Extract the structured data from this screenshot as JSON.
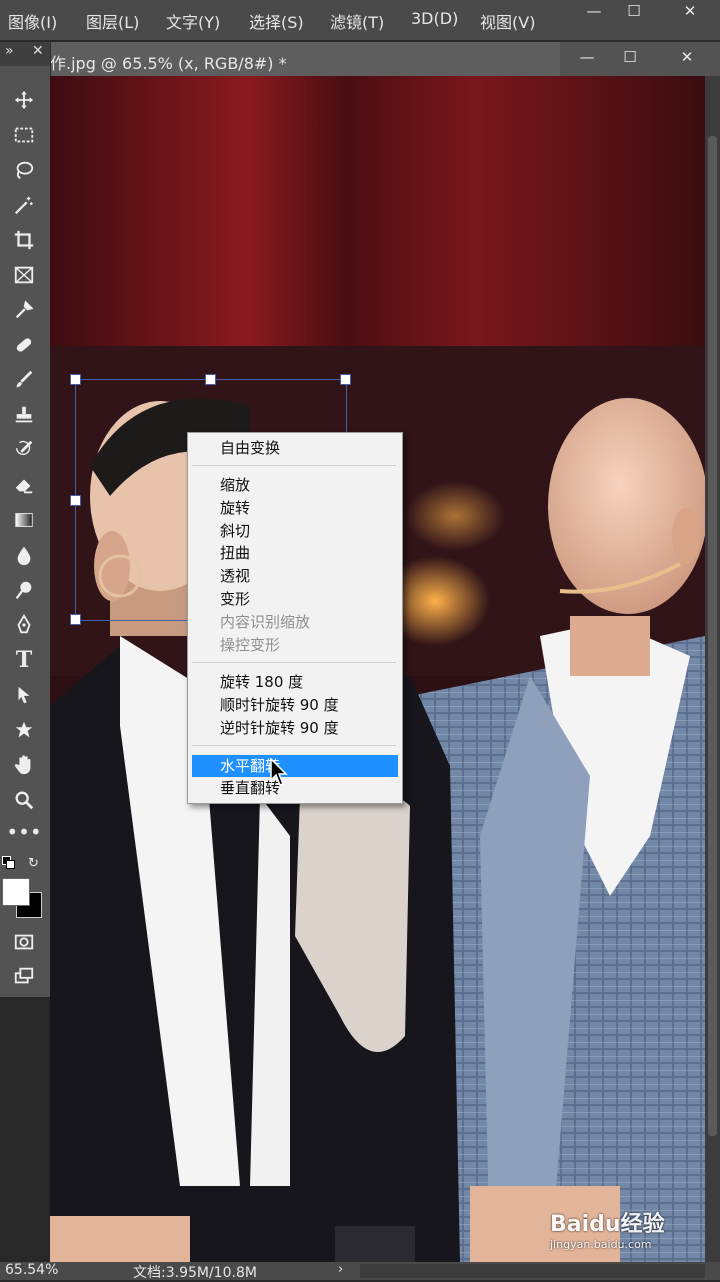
{
  "menubar": {
    "items": [
      "图像(I)",
      "图层(L)",
      "文字(Y)",
      "选择(S)",
      "滤镜(T)",
      "3D(D)",
      "视图(V)"
    ],
    "window_controls": [
      "—",
      "☐",
      "✕"
    ]
  },
  "document": {
    "tab_title": "作.jpg @ 65.5% (x, RGB/8#) *",
    "controls": [
      "—",
      "☐",
      "✕"
    ]
  },
  "toolbar": {
    "header_controls": [
      "»",
      "✕"
    ],
    "tools": [
      "move",
      "marquee",
      "lasso",
      "magic-wand",
      "crop",
      "frame",
      "eyedropper",
      "healing-brush",
      "brush",
      "clone-stamp",
      "history-brush",
      "eraser",
      "gradient",
      "blur",
      "dodge",
      "pen",
      "type",
      "path-selection",
      "shape",
      "hand",
      "zoom",
      "more"
    ]
  },
  "context_menu": {
    "items": [
      {
        "label": "自由变换",
        "enabled": true
      },
      {
        "label": "缩放",
        "enabled": true
      },
      {
        "label": "旋转",
        "enabled": true
      },
      {
        "label": "斜切",
        "enabled": true
      },
      {
        "label": "扭曲",
        "enabled": true
      },
      {
        "label": "透视",
        "enabled": true
      },
      {
        "label": "变形",
        "enabled": true
      },
      {
        "label": "内容识别缩放",
        "enabled": false
      },
      {
        "label": "操控变形",
        "enabled": false
      },
      {
        "label": "旋转 180 度",
        "enabled": true
      },
      {
        "label": "顺时针旋转 90 度",
        "enabled": true
      },
      {
        "label": "逆时针旋转 90 度",
        "enabled": true
      },
      {
        "label": "水平翻转",
        "enabled": true,
        "highlighted": true
      },
      {
        "label": "垂直翻转",
        "enabled": true
      }
    ]
  },
  "statusbar": {
    "zoom": "65.54%",
    "doc_size": "文档:3.95M/10.8M"
  },
  "watermark": {
    "brand": "Baidu经验",
    "url": "jingyan.baidu.com"
  },
  "colors": {
    "highlight": "#1e90ff",
    "panel": "#535353",
    "menubar": "#4a4a4a"
  }
}
